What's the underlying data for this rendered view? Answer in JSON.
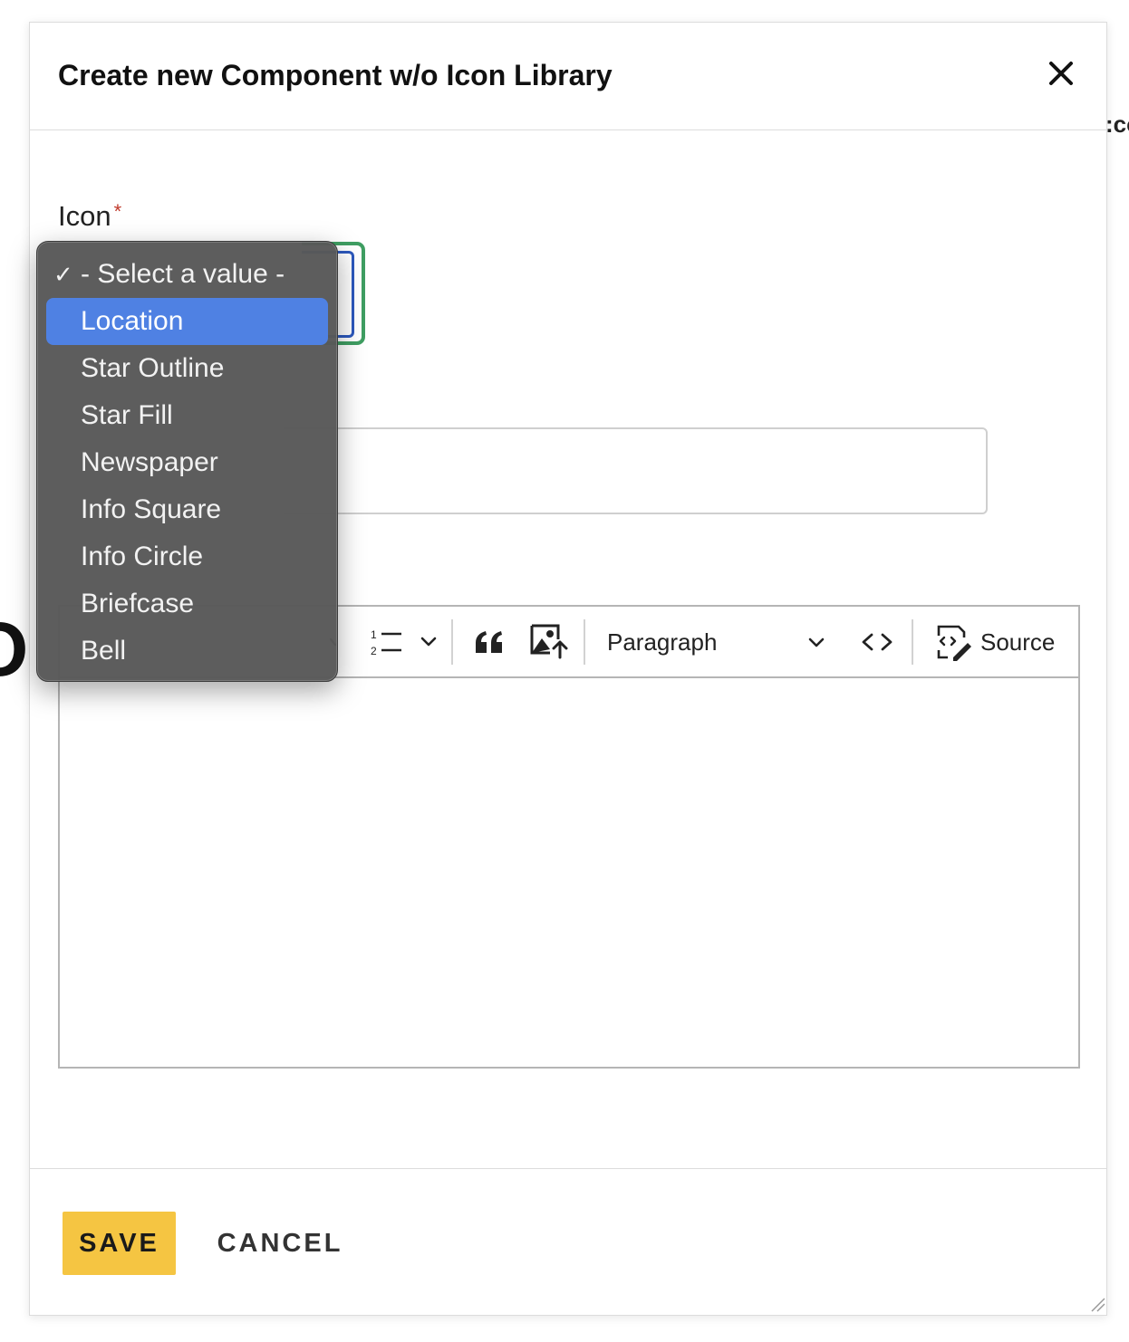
{
  "background": {
    "peek_text": ":co"
  },
  "dialog": {
    "title": "Create new Component w/o Icon Library",
    "close_icon": "close-icon"
  },
  "icon_field": {
    "label": "Icon",
    "required_marker": "*",
    "options": [
      {
        "label": "- Select a value -",
        "checked": true
      },
      {
        "label": "Location",
        "highlighted": true
      },
      {
        "label": "Star Outline"
      },
      {
        "label": "Star Fill"
      },
      {
        "label": "Newspaper"
      },
      {
        "label": "Info Square"
      },
      {
        "label": "Info Circle"
      },
      {
        "label": "Briefcase"
      },
      {
        "label": "Bell"
      }
    ]
  },
  "editor": {
    "toolbar": {
      "heading_select": "Paragraph",
      "source_label": "Source",
      "icons": [
        "chevron-down-icon",
        "numbered-list-icon",
        "block-quote-icon",
        "insert-image-icon",
        "code-block-icon",
        "source-icon"
      ]
    }
  },
  "footer": {
    "save_label": "SAVE",
    "cancel_label": "CANCEL"
  },
  "colors": {
    "save_button": "#f5c542",
    "highlight": "#4f81e3",
    "focus_ring_outer": "#3f9e62",
    "focus_ring_inner": "#2c58bd",
    "required_star": "#c0392b",
    "dropdown_bg": "#585858"
  }
}
